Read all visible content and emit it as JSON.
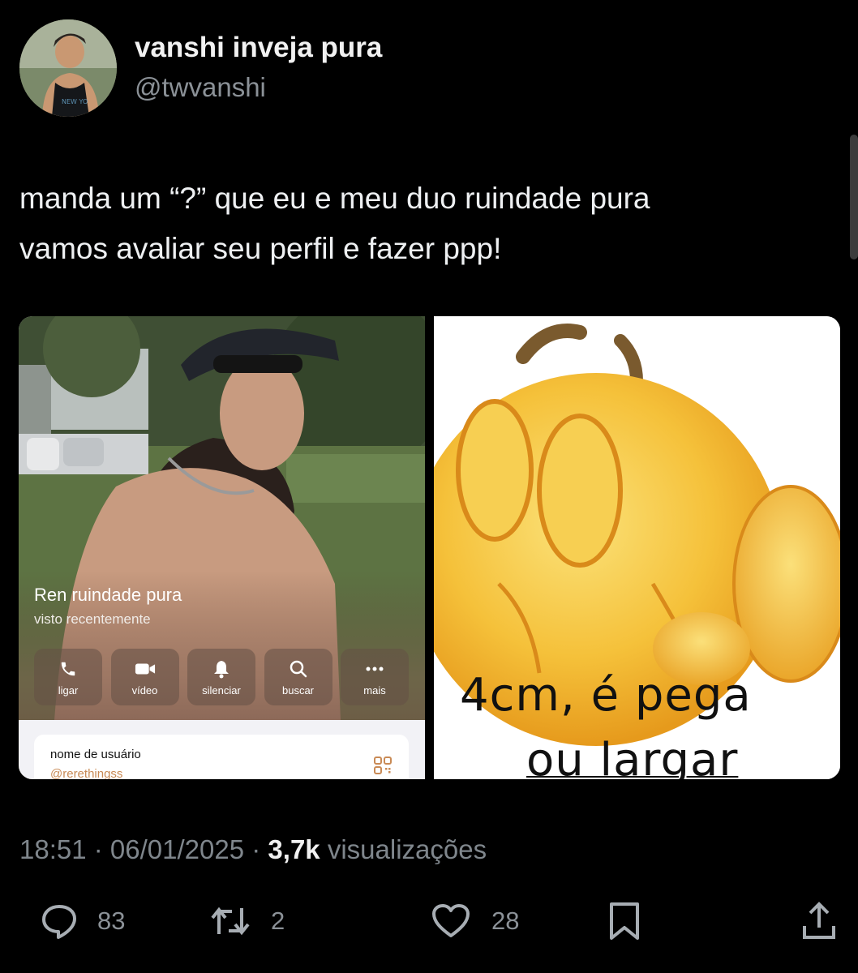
{
  "author": {
    "display_name": "vanshi inveja pura",
    "handle": "@twvanshi",
    "avatar_icon": "profile-photo"
  },
  "tweet": {
    "text_lines": [
      "manda um “?” que eu e meu duo ruindade pura",
      "vamos avaliar seu perfil e fazer ppp!"
    ]
  },
  "media": {
    "left": {
      "contact_name": "Ren ruindade pura",
      "contact_status": "visto recentemente",
      "actions": [
        {
          "label": "ligar",
          "icon": "phone-icon"
        },
        {
          "label": "vídeo",
          "icon": "video-icon"
        },
        {
          "label": "silenciar",
          "icon": "bell-icon"
        },
        {
          "label": "buscar",
          "icon": "search-icon"
        },
        {
          "label": "mais",
          "icon": "more-icon"
        }
      ],
      "username_label": "nome de usuário",
      "username_value": "@rerethingss"
    },
    "right": {
      "caption_line1": "4cm, é pega",
      "caption_line2": "ou largar"
    }
  },
  "meta": {
    "time": "18:51",
    "separator": " · ",
    "date": "06/01/2025",
    "views_count": "3,7k",
    "views_label": "visualizações"
  },
  "actions": {
    "replies": "83",
    "retweets": "2",
    "likes": "28"
  },
  "colors": {
    "background": "#000000",
    "text_primary": "#e7e9ea",
    "text_secondary": "#7f868c",
    "emoji_yellow": "#f4b829"
  }
}
